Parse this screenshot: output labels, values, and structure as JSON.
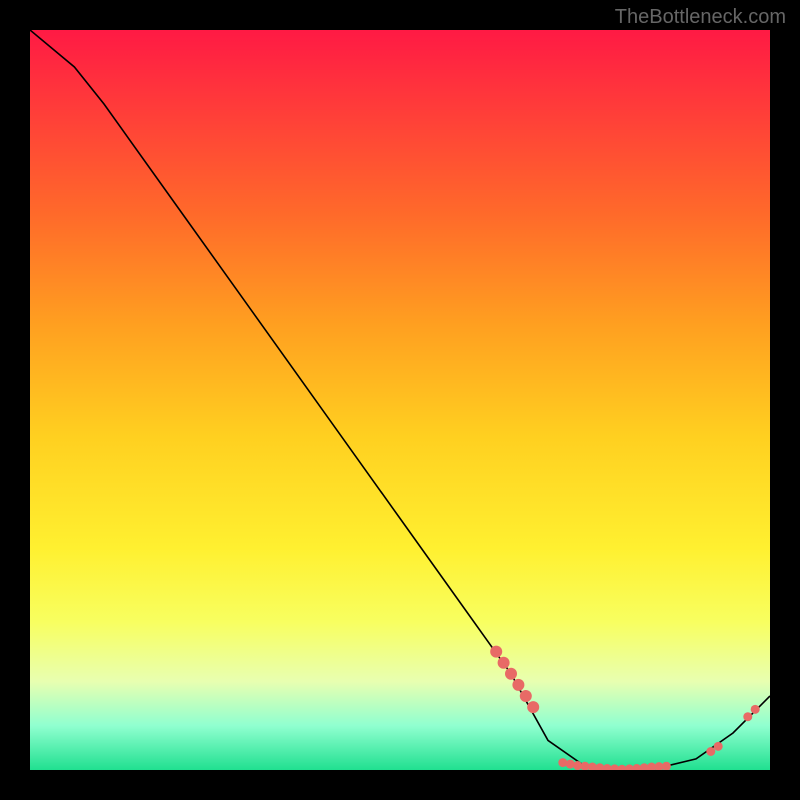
{
  "watermark": "TheBottleneck.com",
  "chart_data": {
    "type": "line",
    "title": "",
    "xlabel": "",
    "ylabel": "",
    "xlim": [
      0,
      100
    ],
    "ylim": [
      0,
      100
    ],
    "curve": [
      {
        "x": 0,
        "y": 100
      },
      {
        "x": 6,
        "y": 95
      },
      {
        "x": 10,
        "y": 90
      },
      {
        "x": 20,
        "y": 76
      },
      {
        "x": 30,
        "y": 62
      },
      {
        "x": 40,
        "y": 48
      },
      {
        "x": 50,
        "y": 34
      },
      {
        "x": 60,
        "y": 20
      },
      {
        "x": 65,
        "y": 13
      },
      {
        "x": 70,
        "y": 4
      },
      {
        "x": 75,
        "y": 0.5
      },
      {
        "x": 80,
        "y": 0
      },
      {
        "x": 85,
        "y": 0.3
      },
      {
        "x": 90,
        "y": 1.5
      },
      {
        "x": 95,
        "y": 5
      },
      {
        "x": 100,
        "y": 10
      }
    ],
    "points_cluster_a": [
      {
        "x": 63,
        "y": 16
      },
      {
        "x": 64,
        "y": 14.5
      },
      {
        "x": 65,
        "y": 13
      },
      {
        "x": 66,
        "y": 11.5
      },
      {
        "x": 67,
        "y": 10
      },
      {
        "x": 68,
        "y": 8.5
      }
    ],
    "points_cluster_b": [
      {
        "x": 72,
        "y": 1
      },
      {
        "x": 73,
        "y": 0.8
      },
      {
        "x": 74,
        "y": 0.6
      },
      {
        "x": 75,
        "y": 0.5
      },
      {
        "x": 76,
        "y": 0.4
      },
      {
        "x": 77,
        "y": 0.3
      },
      {
        "x": 78,
        "y": 0.2
      },
      {
        "x": 79,
        "y": 0.15
      },
      {
        "x": 80,
        "y": 0.1
      },
      {
        "x": 81,
        "y": 0.15
      },
      {
        "x": 82,
        "y": 0.2
      },
      {
        "x": 83,
        "y": 0.3
      },
      {
        "x": 84,
        "y": 0.4
      },
      {
        "x": 85,
        "y": 0.45
      },
      {
        "x": 86,
        "y": 0.5
      }
    ],
    "points_cluster_c": [
      {
        "x": 92,
        "y": 2.5
      },
      {
        "x": 93,
        "y": 3.2
      },
      {
        "x": 97,
        "y": 7.2
      },
      {
        "x": 98,
        "y": 8.2
      }
    ]
  }
}
